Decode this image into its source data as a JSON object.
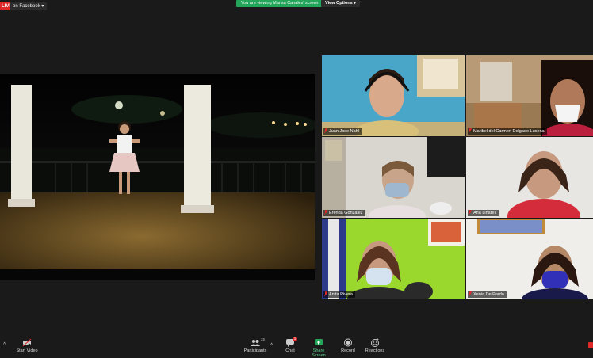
{
  "topbar": {
    "live_label": "LIVE",
    "live_platform": "on Facebook",
    "viewing_text": "You are viewing Marisa Canales' screen",
    "view_options": "View Options"
  },
  "participants": [
    {
      "name": "Juan Jose Nahl"
    },
    {
      "name": "Maribel del Carmen Delgado Lucena"
    },
    {
      "name": "Erenda Gonzalez"
    },
    {
      "name": "Ana Linares"
    },
    {
      "name": "Anita Rivera"
    },
    {
      "name": "Xenia De Pardo"
    }
  ],
  "toolbar": {
    "start_video": "Start Video",
    "participants": "Participants",
    "participants_count": "25",
    "chat": "Chat",
    "chat_badge": "1",
    "share_screen": "Share Screen",
    "record": "Record",
    "reactions": "Reactions"
  },
  "colors": {
    "share_green": "#23a55a",
    "live_red": "#e02828",
    "background": "#1a1a1a"
  }
}
